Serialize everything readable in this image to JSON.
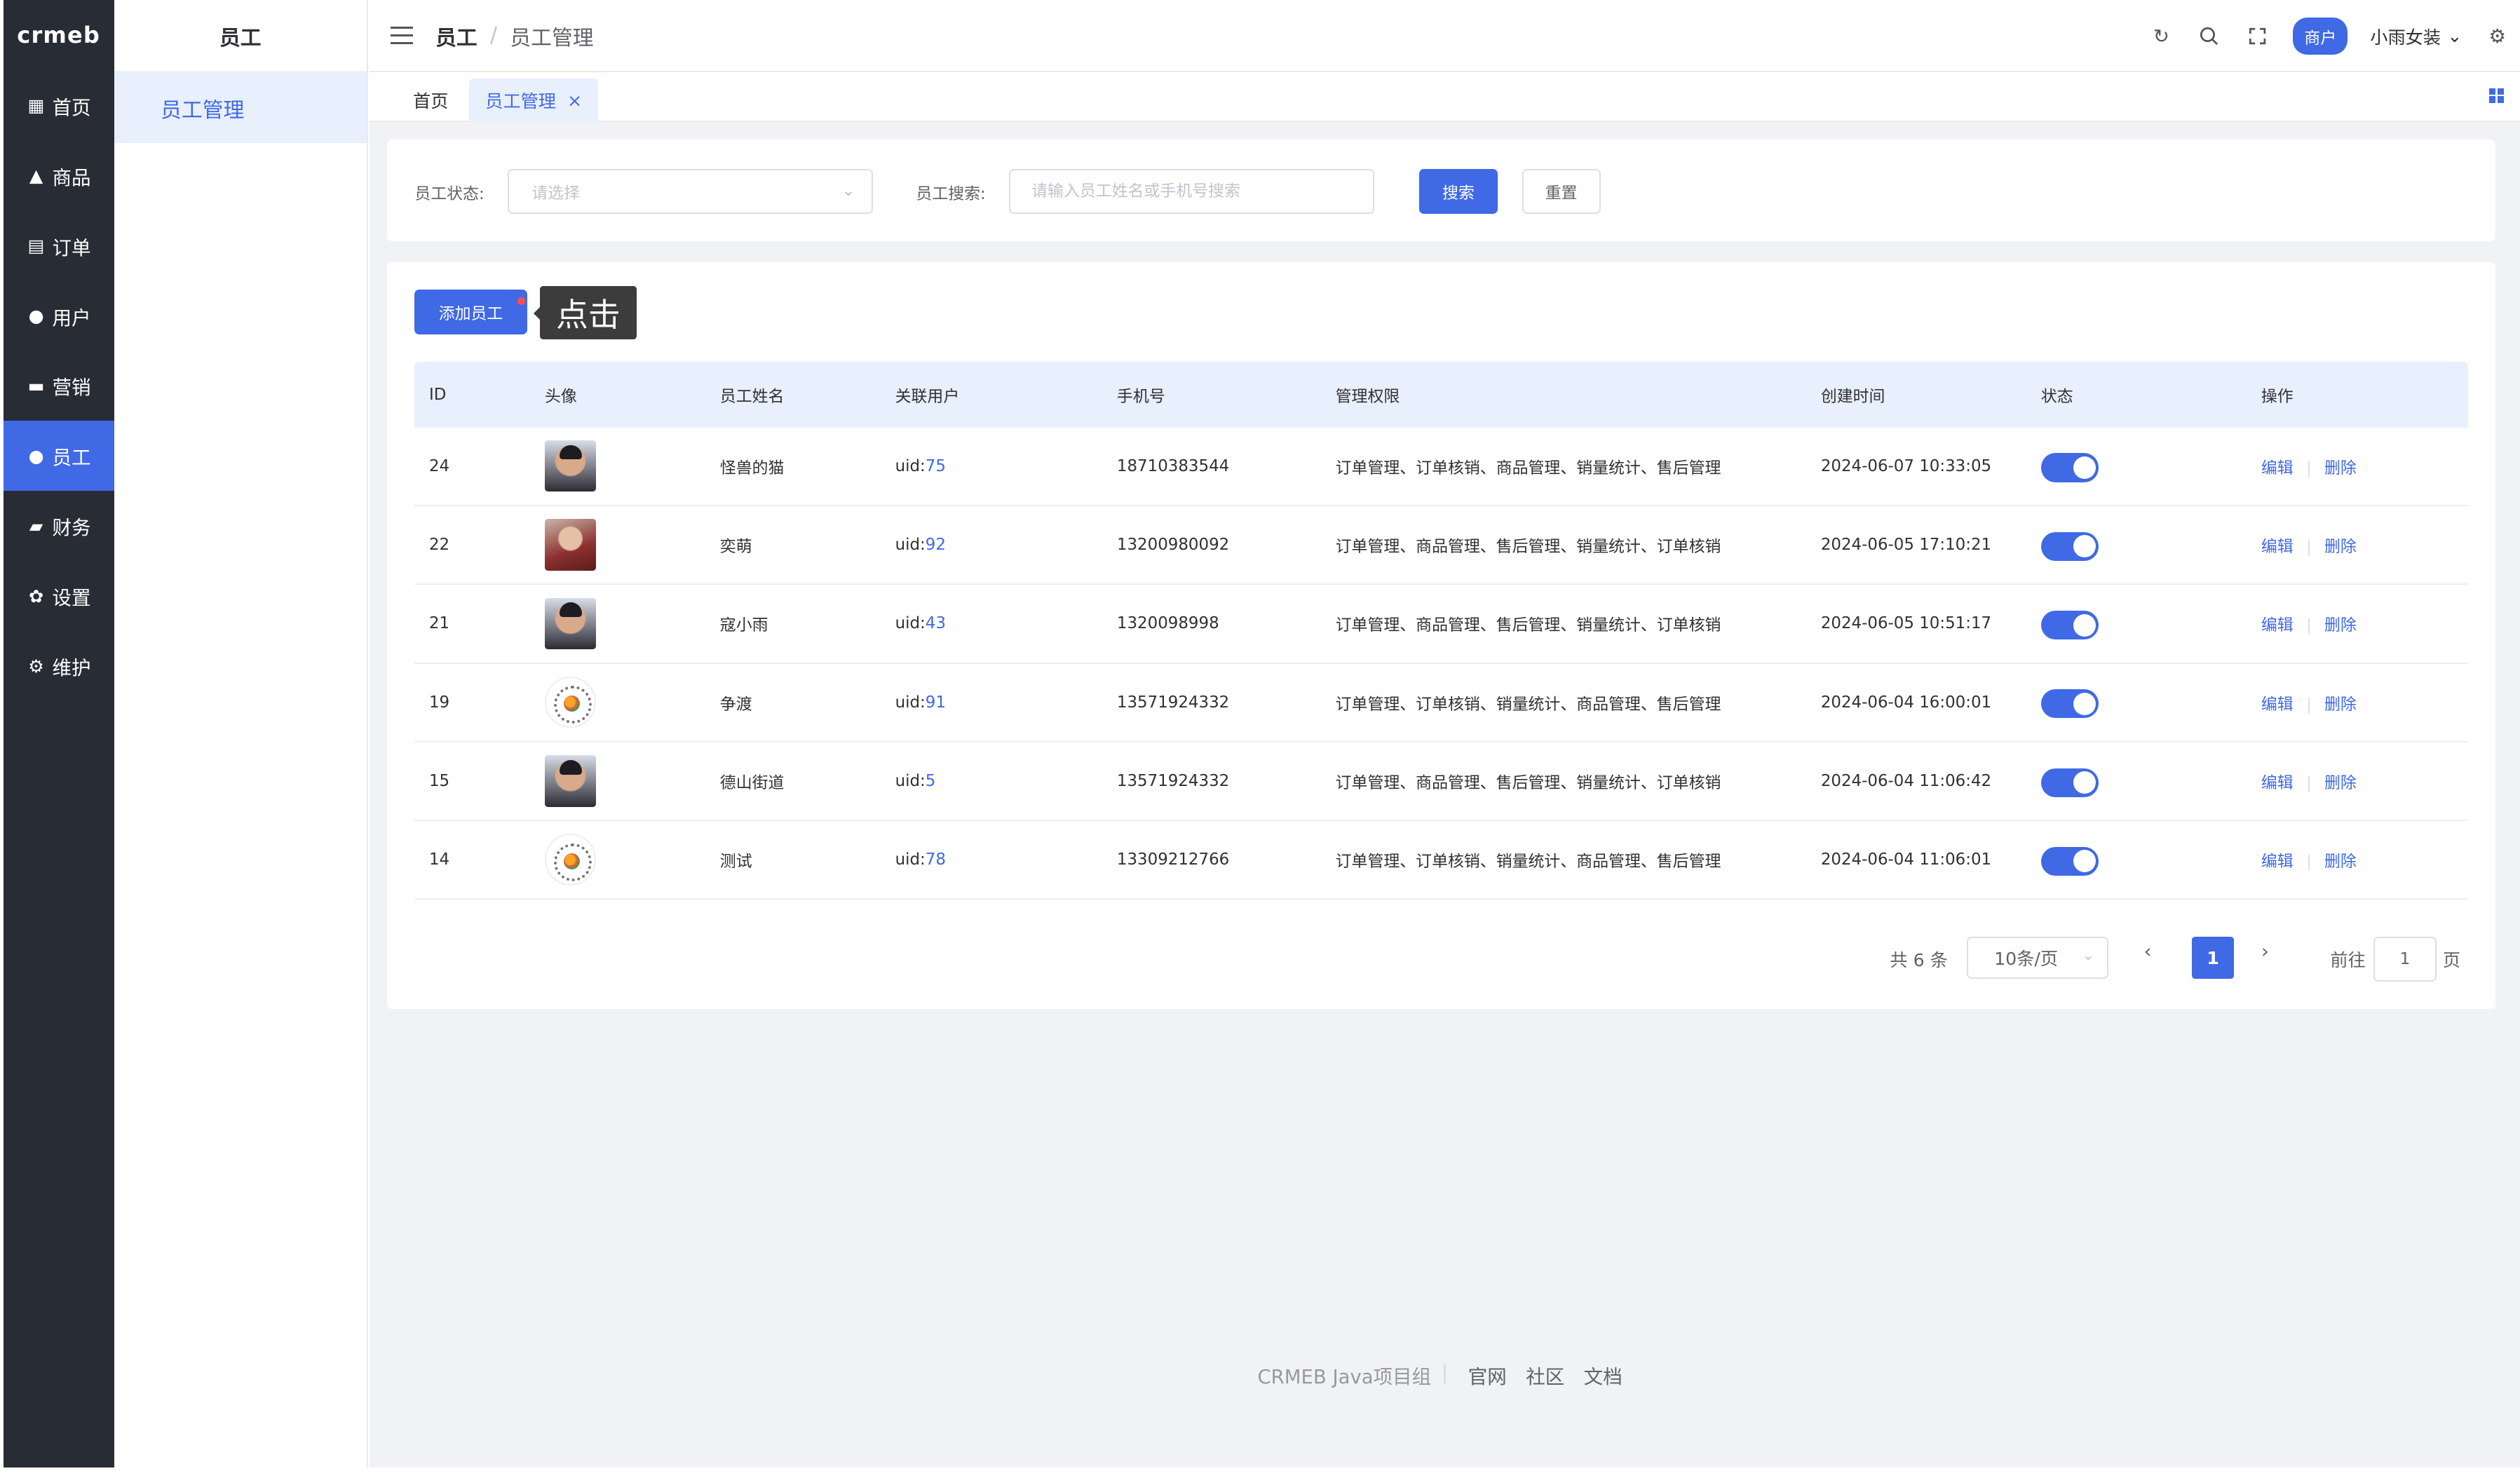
{
  "logo": "crmeb",
  "rail": [
    {
      "icon": "▦",
      "label": "首页",
      "active": false
    },
    {
      "icon": "▲",
      "label": "商品",
      "active": false
    },
    {
      "icon": "▤",
      "label": "订单",
      "active": false
    },
    {
      "icon": "●",
      "label": "用户",
      "active": false
    },
    {
      "icon": "▬",
      "label": "营销",
      "active": false
    },
    {
      "icon": "●",
      "label": "员工",
      "active": true
    },
    {
      "icon": "▰",
      "label": "财务",
      "active": false
    },
    {
      "icon": "✿",
      "label": "设置",
      "active": false
    },
    {
      "icon": "⚙",
      "label": "维护",
      "active": false
    }
  ],
  "sub_sidebar": {
    "title": "员工",
    "item": "员工管理"
  },
  "header": {
    "breadcrumb_1": "员工",
    "breadcrumb_sep": "/",
    "breadcrumb_2": "员工管理",
    "merchant_badge": "商户",
    "store_name": "小雨女装"
  },
  "tabs": {
    "home": "首页",
    "active": "员工管理"
  },
  "filter": {
    "status_label": "员工状态:",
    "status_placeholder": "请选择",
    "search_label": "员工搜索:",
    "search_placeholder": "请输入员工姓名或手机号搜索",
    "search_button": "搜索",
    "reset_button": "重置"
  },
  "toolbar": {
    "add_button": "添加员工",
    "tooltip": "点击"
  },
  "table": {
    "headers": [
      "ID",
      "头像",
      "员工姓名",
      "关联用户",
      "手机号",
      "管理权限",
      "创建时间",
      "状态",
      "操作"
    ],
    "rows": [
      {
        "id": "24",
        "avatar": "woman",
        "name": "怪兽的猫",
        "uid_prefix": "uid:",
        "uid": "75",
        "phone": "18710383544",
        "perms": "订单管理、订单核销、商品管理、销量统计、售后管理",
        "created": "2024-06-07 10:33:05",
        "status": true
      },
      {
        "id": "22",
        "avatar": "red",
        "name": "奕萌",
        "uid_prefix": "uid:",
        "uid": "92",
        "phone": "13200980092",
        "perms": "订单管理、商品管理、售后管理、销量统计、订单核销",
        "created": "2024-06-05 17:10:21",
        "status": true
      },
      {
        "id": "21",
        "avatar": "woman",
        "name": "寇小雨",
        "uid_prefix": "uid:",
        "uid": "43",
        "phone": "1320098998",
        "perms": "订单管理、商品管理、售后管理、销量统计、订单核销",
        "created": "2024-06-05 10:51:17",
        "status": true
      },
      {
        "id": "19",
        "avatar": "qr",
        "name": "争渡",
        "uid_prefix": "uid:",
        "uid": "91",
        "phone": "13571924332",
        "perms": "订单管理、订单核销、销量统计、商品管理、售后管理",
        "created": "2024-06-04 16:00:01",
        "status": true
      },
      {
        "id": "15",
        "avatar": "woman",
        "name": "德山街道",
        "uid_prefix": "uid:",
        "uid": "5",
        "phone": "13571924332",
        "perms": "订单管理、商品管理、售后管理、销量统计、订单核销",
        "created": "2024-06-04 11:06:42",
        "status": true
      },
      {
        "id": "14",
        "avatar": "qr",
        "name": "测试",
        "uid_prefix": "uid:",
        "uid": "78",
        "phone": "13309212766",
        "perms": "订单管理、订单核销、销量统计、商品管理、售后管理",
        "created": "2024-06-04 11:06:01",
        "status": true
      }
    ],
    "edit_label": "编辑",
    "op_sep": "|",
    "delete_label": "删除"
  },
  "pagination": {
    "total": "共 6 条",
    "page_size": "10条/页",
    "current_page": "1",
    "goto_label": "前往",
    "goto_value": "1",
    "page_suffix": "页"
  },
  "footer": {
    "brand": "CRMEB Java项目组",
    "links": [
      "官网",
      "社区",
      "文档"
    ]
  },
  "colors": {
    "accent": "#4069e5",
    "rail_bg": "#282c35",
    "page_bg": "#f0f2f5"
  }
}
